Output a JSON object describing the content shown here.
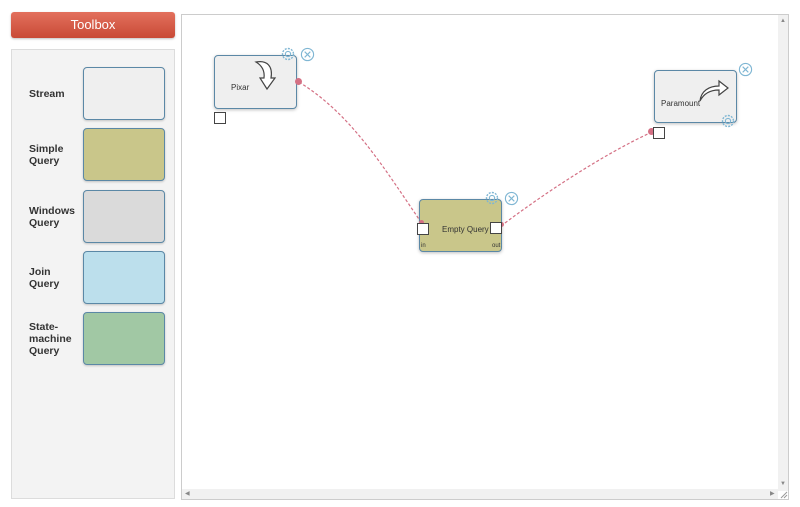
{
  "toolbox": {
    "title": "Toolbox",
    "items": [
      {
        "label": "Stream",
        "color": "#efefef"
      },
      {
        "label": "Simple Query",
        "color": "#c9c68a"
      },
      {
        "label": "Windows Query",
        "color": "#dadada"
      },
      {
        "label": "Join Query",
        "color": "#bcdfec"
      },
      {
        "label": "State-machine Query",
        "color": "#a1c8a4"
      }
    ]
  },
  "canvas": {
    "nodes": {
      "pixar": {
        "label": "Pixar",
        "color": "#efefef",
        "icon": "import-arrow-icon"
      },
      "query": {
        "label": "Empty Query",
        "color": "#c9c68a",
        "in_label": "in",
        "out_label": "out"
      },
      "paramount": {
        "label": "Paramount",
        "color": "#efefef",
        "icon": "export-arrow-icon"
      }
    },
    "connection_color": "#d47084",
    "icon_color": "#7fb6d3"
  }
}
